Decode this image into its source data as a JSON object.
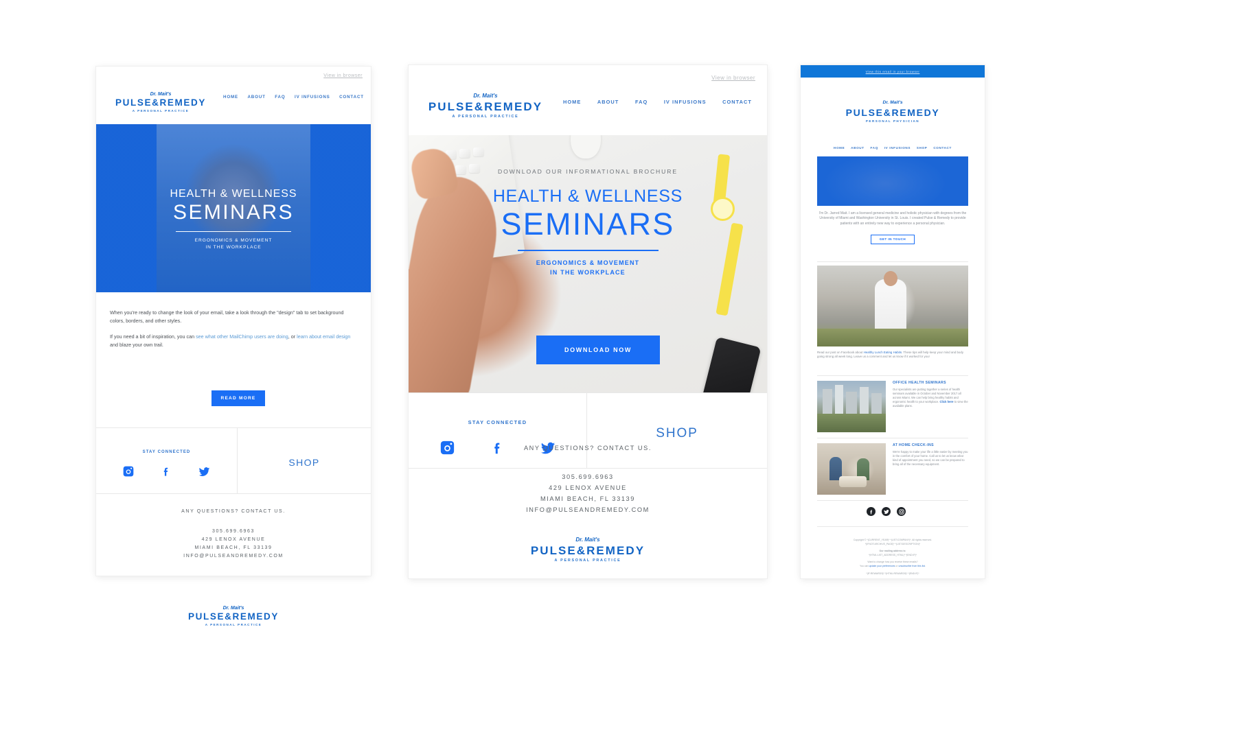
{
  "brand": {
    "accent": "#1a6ef5",
    "logo_blue": "#1264c4",
    "dr_line": "Dr. Mait's",
    "name": "PULSE&REMEDY",
    "tagline_practice": "A PERSONAL PRACTICE",
    "tagline_physician": "PERSONAL PHYSICIAN"
  },
  "panel1": {
    "view_in_browser": "View in browser",
    "nav": [
      "HOME",
      "ABOUT",
      "FAQ",
      "IV INFUSIONS",
      "CONTACT"
    ],
    "hero": {
      "title_line1": "HEALTH & WELLNESS",
      "title_line2": "SEMINARS",
      "sub_line1": "ERGONOMICS & MOVEMENT",
      "sub_line2": "IN THE WORKPLACE"
    },
    "body": {
      "para1": "When you're ready to change the look of your email, take a look through the \"design\" tab to set background colors, borders, and other styles.",
      "para2_pre": "If you need a bit of inspiration, you can ",
      "para2_link1": "see what other MailChimp users are doing",
      "para2_mid": ", or ",
      "para2_link2": "learn about email design",
      "para2_post": " and blaze your own trail.",
      "button": "READ MORE"
    },
    "social": {
      "stay_connected": "STAY CONNECTED",
      "icons": [
        "instagram-icon",
        "facebook-icon",
        "twitter-icon"
      ],
      "shop": "SHOP"
    },
    "contact": {
      "heading": "ANY QUESTIONS? CONTACT US.",
      "phone": "305.699.6963",
      "address1": "429 LENOX AVENUE",
      "address2": "MIAMI BEACH, FL 33139",
      "email": "INFO@PULSEANDREMEDY.COM"
    }
  },
  "panel2": {
    "view_in_browser": "View in browser",
    "nav": [
      "HOME",
      "ABOUT",
      "FAQ",
      "IV INFUSIONS",
      "CONTACT"
    ],
    "hero": {
      "eyebrow": "DOWNLOAD OUR INFORMATIONAL BROCHURE",
      "title_line1": "HEALTH & WELLNESS",
      "title_line2": "SEMINARS",
      "sub_line1": "ERGONOMICS & MOVEMENT",
      "sub_line2": "IN THE WORKPLACE",
      "button": "DOWNLOAD NOW"
    },
    "social": {
      "stay_connected": "STAY CONNECTED",
      "icons": [
        "instagram-icon",
        "facebook-icon",
        "twitter-icon"
      ],
      "shop": "SHOP"
    },
    "contact": {
      "heading": "ANY QUESTIONS? CONTACT US.",
      "phone": "305.699.6963",
      "address1": "429 LENOX AVENUE",
      "address2": "MIAMI BEACH, FL 33139",
      "email": "INFO@PULSEANDREMEDY.COM"
    }
  },
  "panel3": {
    "view_in_browser": "View this email in your browser",
    "nav": [
      "HOME",
      "ABOUT",
      "FAQ",
      "IV INFUSIONS",
      "SHOP",
      "CONTACT"
    ],
    "intro": {
      "text": "I'm Dr. Jarred Mait. I am a licensed general medicine and holistic physician with degrees from the University of Miami and Washington University in St. Louis. I created Pulse & Remedy to provide patients with an entirely new way to experience a personal physician.",
      "button": "GET IN TOUCH"
    },
    "blog": {
      "pre": "Read our post on Facebook about ",
      "link": "Healthy Lunch Eating Habits",
      "post": ". These tips will help keep your mind and body going strong all week long. Leave us a comment and let us know if it worked for you!"
    },
    "cards": [
      {
        "title": "OFFICE HEALTH SEMINARS",
        "text_pre": "Our specialists are putting together a series of health seminars available in October and November 2017 all across Miami. We can help bring healthy habits and ergonomic health to your workplace. ",
        "link": "Click here",
        "text_post": " to view the available plans.",
        "image": "city-skyline-photo"
      },
      {
        "title": "AT HOME CHECK-INS",
        "text_pre": "We're happy to make your life a little easier by meeting you in the comfort of your home. Call us to let us know what kind of appointment you need, so we can be prepared to bring all of the necessary equipment.",
        "link": "",
        "text_post": "",
        "image": "home-visit-photo"
      }
    ],
    "social_icons": [
      "facebook-icon",
      "twitter-icon",
      "instagram-icon"
    ],
    "footer": {
      "line1": "Copyright © *|CURRENT_YEAR|* *|LIST:COMPANY|*, All rights reserved.",
      "line2": "*|IFNOT:ARCHIVE_PAGE|* *|LIST:DESCRIPTION|*",
      "line3": "Our mailing address is:",
      "line4": "*|HTML:LIST_ADDRESS_HTML|* *|END:IF|*",
      "line5": "Want to change how you receive these emails?",
      "line6_pre": "You can ",
      "line6_link1": "update your preferences",
      "line6_mid": " or ",
      "line6_link2": "unsubscribe from this list",
      "line6_post": ".",
      "line7": "*|IF:REWARDS|* *|HTML:REWARDS|* *|END:IF|*"
    }
  }
}
